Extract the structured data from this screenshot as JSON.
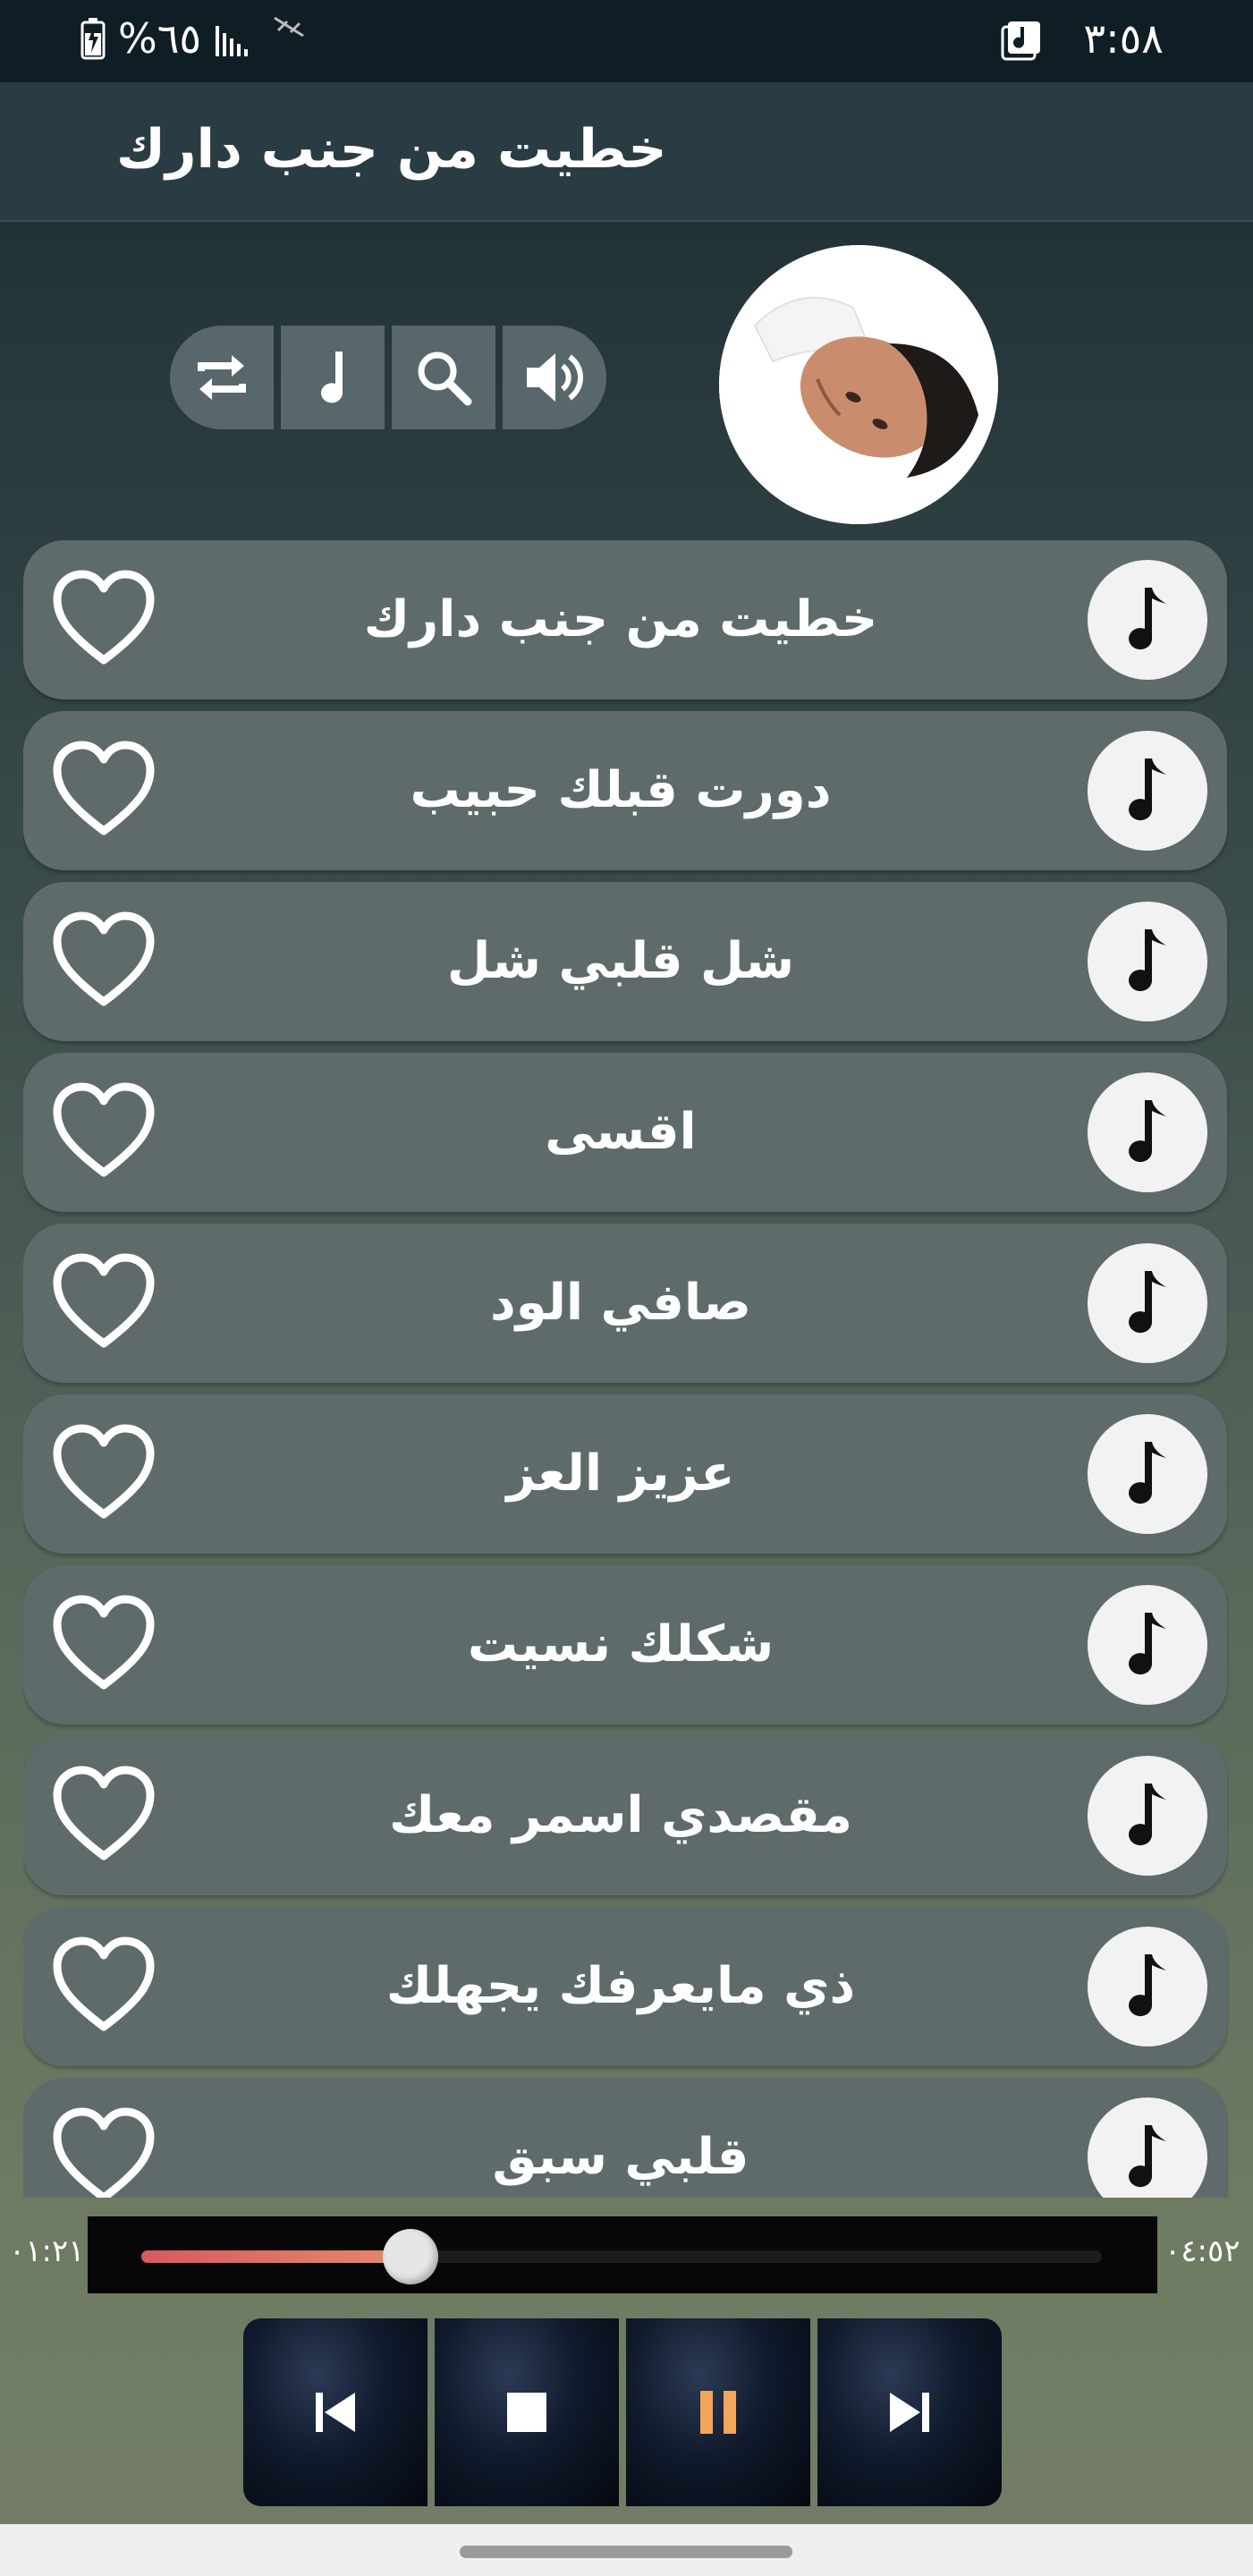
{
  "status_bar": {
    "time": "٣:٥٨",
    "battery": "%٦٥"
  },
  "app_bar": {
    "title": "خطيت من جنب دارك"
  },
  "controls": [
    {
      "name": "repeat",
      "icon": "repeat-icon"
    },
    {
      "name": "music",
      "icon": "music-note-icon"
    },
    {
      "name": "search",
      "icon": "search-icon"
    },
    {
      "name": "volume",
      "icon": "volume-icon"
    }
  ],
  "songs": [
    {
      "title": "خطيت من جنب دارك"
    },
    {
      "title": "دورت قبلك حبيب"
    },
    {
      "title": "شل قلبي شل"
    },
    {
      "title": "اقسى"
    },
    {
      "title": "صافي الود"
    },
    {
      "title": "عزيز العز"
    },
    {
      "title": "شكلك نسيت"
    },
    {
      "title": "مقصدي اسمر معك"
    },
    {
      "title": "ذي مايعرفك يجهلك"
    },
    {
      "title": "قلبي سبق"
    }
  ],
  "player": {
    "elapsed": "٠١:٢١",
    "duration": "٠٤:٥٢",
    "progress": 0.28,
    "buttons": [
      "previous-icon",
      "stop-icon",
      "pause-icon",
      "next-icon"
    ],
    "pause_color": "#f2a65a"
  },
  "colors": {
    "accent": "#d75a5f",
    "row_bg": "#5f6b6b"
  }
}
